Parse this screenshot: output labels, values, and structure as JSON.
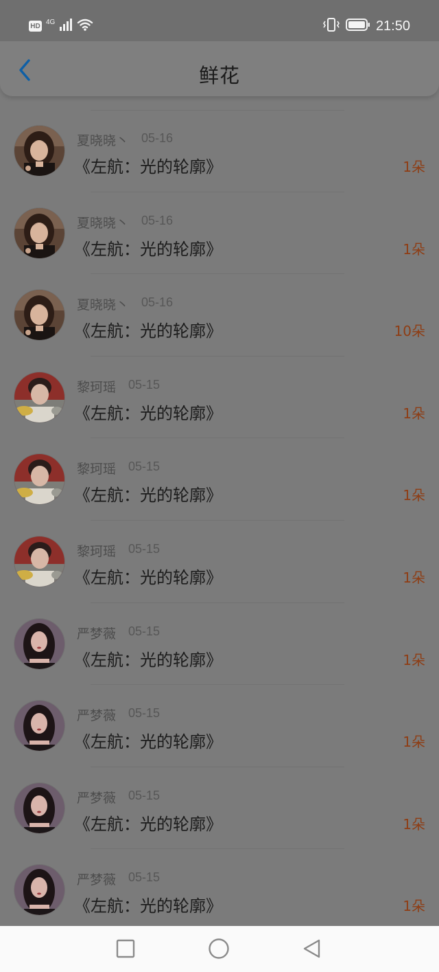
{
  "status_bar": {
    "hd_label": "HD",
    "network_label": "4G",
    "time": "21:50",
    "icons": [
      "hd-icon",
      "signal-icon",
      "wifi-icon",
      "vibrate-icon",
      "battery-icon"
    ]
  },
  "header": {
    "title": "鲜花",
    "back_icon": "chevron-left-icon",
    "accent_color": "#0e5fa6"
  },
  "items": [
    {
      "name": "夏晓晓丶",
      "date": "05-16",
      "title": "《左航：光的轮廓》",
      "count": "1朵",
      "avatar": "girl-a"
    },
    {
      "name": "夏晓晓丶",
      "date": "05-16",
      "title": "《左航：光的轮廓》",
      "count": "1朵",
      "avatar": "girl-a"
    },
    {
      "name": "夏晓晓丶",
      "date": "05-16",
      "title": "《左航：光的轮廓》",
      "count": "10朵",
      "avatar": "girl-a"
    },
    {
      "name": "黎珂瑶",
      "date": "05-15",
      "title": "《左航：光的轮廓》",
      "count": "1朵",
      "avatar": "boy-b"
    },
    {
      "name": "黎珂瑶",
      "date": "05-15",
      "title": "《左航：光的轮廓》",
      "count": "1朵",
      "avatar": "boy-b"
    },
    {
      "name": "黎珂瑶",
      "date": "05-15",
      "title": "《左航：光的轮廓》",
      "count": "1朵",
      "avatar": "boy-b"
    },
    {
      "name": "严梦薇",
      "date": "05-15",
      "title": "《左航：光的轮廓》",
      "count": "1朵",
      "avatar": "girl-c"
    },
    {
      "name": "严梦薇",
      "date": "05-15",
      "title": "《左航：光的轮廓》",
      "count": "1朵",
      "avatar": "girl-c"
    },
    {
      "name": "严梦薇",
      "date": "05-15",
      "title": "《左航：光的轮廓》",
      "count": "1朵",
      "avatar": "girl-c"
    },
    {
      "name": "严梦薇",
      "date": "05-15",
      "title": "《左航：光的轮廓》",
      "count": "1朵",
      "avatar": "girl-c"
    }
  ],
  "nav_bar": {
    "icons": [
      "recent-apps-icon",
      "home-icon",
      "back-icon"
    ]
  },
  "colors": {
    "count_color": "#8e3d14",
    "overlay_background": "#7b7b7b"
  }
}
